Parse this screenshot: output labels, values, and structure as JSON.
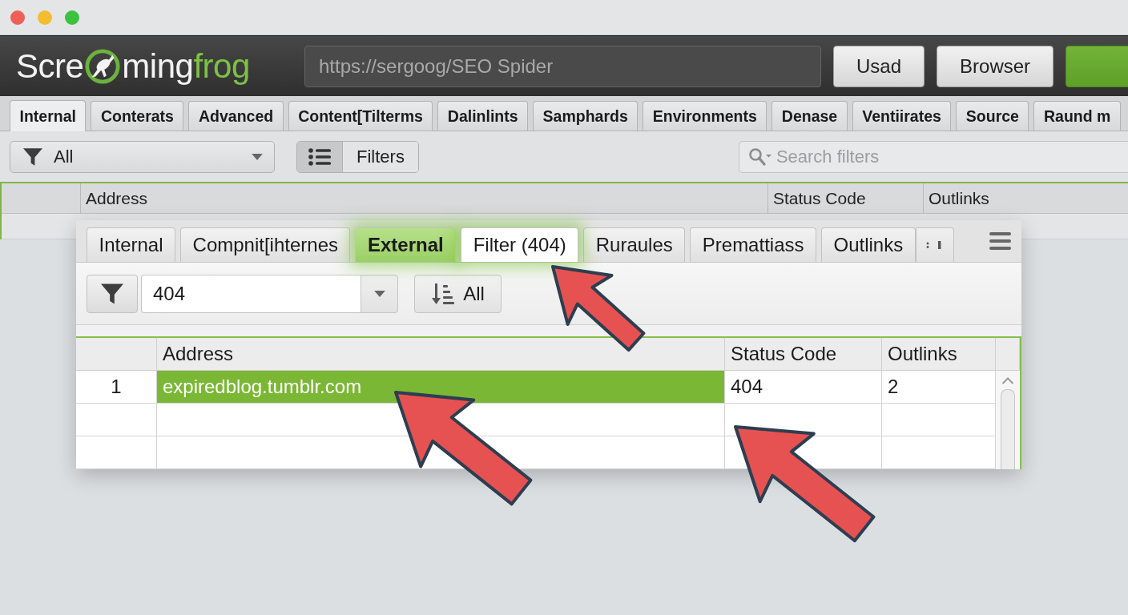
{
  "header": {
    "logo": {
      "start": "Scre",
      "middle": "ming",
      "end": "frog"
    },
    "url_field": {
      "placeholder": "https://sergoog/SEO Spider"
    },
    "buttons": [
      {
        "kind": "plain",
        "label": "Usad"
      },
      {
        "kind": "plain",
        "label": "Browser"
      },
      {
        "kind": "primary"
      }
    ]
  },
  "tabs": [
    {
      "label": "Internal",
      "selected": true
    },
    {
      "label": "Conterats",
      "selected": false
    },
    {
      "label": "Advanced",
      "selected": false
    },
    {
      "label": "Content[Tilterms",
      "selected": false
    },
    {
      "label": "Dalinlints",
      "selected": false
    },
    {
      "label": "Samphards",
      "selected": false
    },
    {
      "label": "Environments",
      "selected": false
    },
    {
      "label": "Denase",
      "selected": false
    },
    {
      "label": "Ventiirates",
      "selected": false
    },
    {
      "label": "Source",
      "selected": false
    },
    {
      "label": "Raund m",
      "selected": false
    }
  ],
  "filter_bar": {
    "filter_dropdown": {
      "value": "All"
    },
    "view_toggle": {
      "list_selected": true,
      "label": "Filters"
    },
    "search": {
      "placeholder": "Search filters"
    }
  },
  "table": {
    "columns": [
      "Address",
      "Status Code",
      "Outlinks"
    ]
  },
  "panel": {
    "tabs": [
      {
        "label": "Internal",
        "selected": false,
        "highlighted": false
      },
      {
        "label": "Compnit[ihternes",
        "selected": false,
        "highlighted": false
      },
      {
        "label": "External",
        "selected": true,
        "highlighted": true
      },
      {
        "label": "Filter (404)",
        "selected": false,
        "highlighted": true
      },
      {
        "label": "Ruraules",
        "selected": false,
        "highlighted": false
      },
      {
        "label": "Premattiass",
        "selected": false,
        "highlighted": false
      },
      {
        "label": "Outlinks",
        "selected": false,
        "highlighted": false
      }
    ],
    "filter": {
      "value": "404"
    },
    "sort_button": {
      "label": "All"
    },
    "table": {
      "columns": [
        "Address",
        "Status Code",
        "Outlinks"
      ],
      "rows": [
        {
          "number": "1",
          "address": "expiredblog.tumblr.com",
          "status_code": "404",
          "outlinks": "2",
          "selected": true
        }
      ]
    }
  }
}
